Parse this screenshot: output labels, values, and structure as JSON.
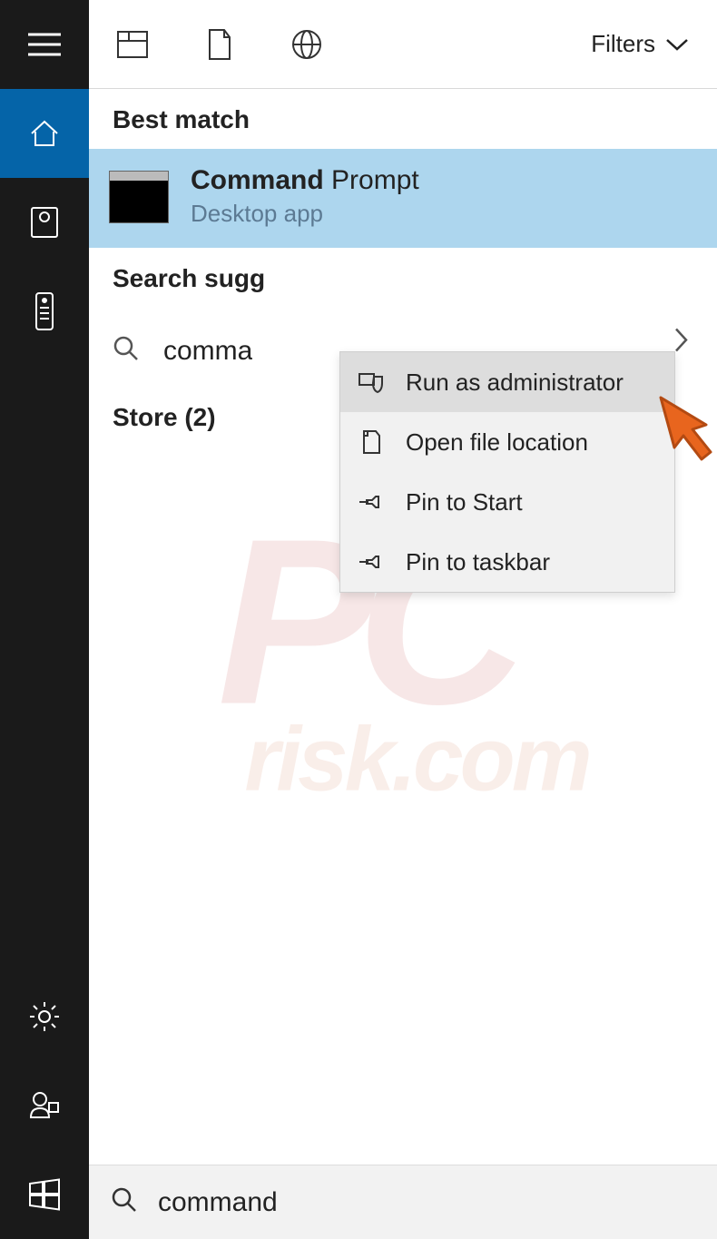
{
  "top": {
    "filters_label": "Filters"
  },
  "sections": {
    "best_match": "Best match",
    "search_suggestions": "Search sugg",
    "store": "Store (2)"
  },
  "best_result": {
    "title_bold": "Command",
    "title_rest": " Prompt",
    "subtitle": "Desktop app"
  },
  "suggestion": {
    "text": "comma"
  },
  "context_menu": {
    "items": [
      {
        "label": "Run as administrator",
        "icon": "shield"
      },
      {
        "label": "Open file location",
        "icon": "folder"
      },
      {
        "label": "Pin to Start",
        "icon": "pin"
      },
      {
        "label": "Pin to taskbar",
        "icon": "pin"
      }
    ]
  },
  "search": {
    "value": "command"
  },
  "watermark": {
    "line1": "PC",
    "line2": "risk.com"
  }
}
